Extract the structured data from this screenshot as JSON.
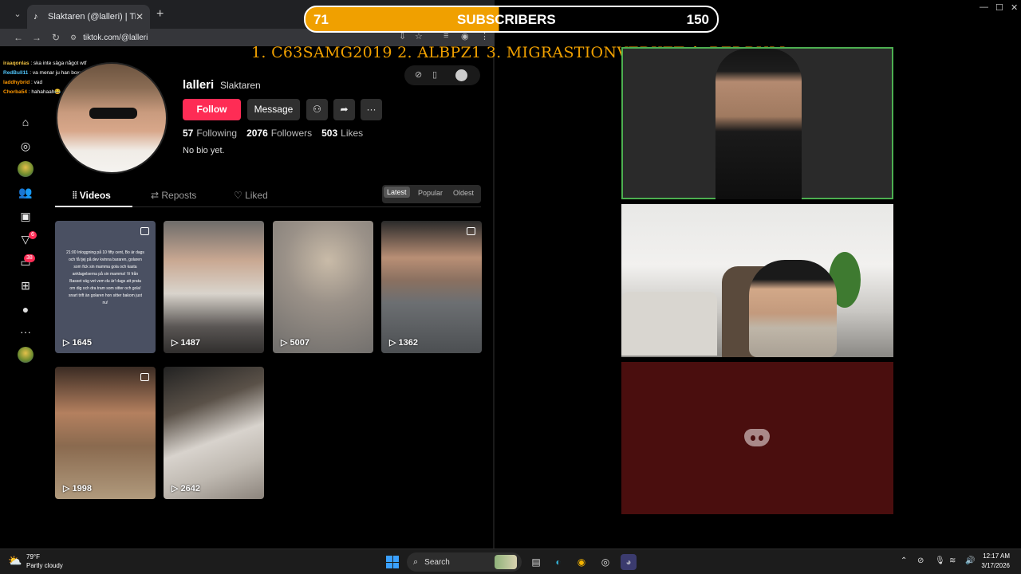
{
  "browser": {
    "tab_title": "Slaktaren (@lalleri) | TikTok",
    "url": "tiktok.com/@lalleri"
  },
  "banner": {
    "left_count": "71",
    "label": "SUBSCRIBERS",
    "right_count": "150",
    "leaderboard": "1. C63SAMG2019  2. ALBPZ1   3. MIGRASTIONVERKET  4. REDBULL"
  },
  "chat": [
    {
      "user": "iraaqonlas",
      "text": " : ska inte säga något wtf",
      "color": "#f5c542"
    },
    {
      "user": "RedBull11",
      "text": " : va menar ju han boxaren",
      "color": "#4fc3f7"
    },
    {
      "user": "laddhybrid",
      "text": " : vad",
      "color": "#ff9800"
    },
    {
      "user": "Chorba54",
      "text": " : hahahaah😂",
      "color": "#ff9800"
    }
  ],
  "sidebar": {
    "badge_messages": "38",
    "badge_activity": "6"
  },
  "profile": {
    "username": "lalleri",
    "nickname": "Slaktaren",
    "follow_label": "Follow",
    "message_label": "Message",
    "following_count": "57",
    "following_label": "Following",
    "followers_count": "2076",
    "followers_label": "Followers",
    "likes_count": "503",
    "likes_label": "Likes",
    "bio": "No bio yet."
  },
  "tabs": {
    "videos": "Videos",
    "reposts": "Reposts",
    "liked": "Liked"
  },
  "sort": {
    "latest": "Latest",
    "popular": "Popular",
    "oldest": "Oldest"
  },
  "videos": [
    {
      "views": "1645",
      "overlay_text": "21:00 Inloggning på 10 fifty cent, Bo är dags och få tjej på dev kvinna bararen, golaren som fick sin mamma gola och kasta anklagelserna på sin mamma! Vi från Basset väg vet vem du är! dags att prata om dig och dra tram som sitter och gola! snart trift än golaren hon sitter bakom just nu!"
    },
    {
      "views": "1487"
    },
    {
      "views": "5007"
    },
    {
      "views": "1362"
    },
    {
      "views": "1998"
    },
    {
      "views": "2642"
    }
  ],
  "taskbar": {
    "temp": "79°F",
    "weather": "Partly cloudy",
    "search": "Search",
    "time": "12:17 AM",
    "date": "3/17/2026"
  }
}
